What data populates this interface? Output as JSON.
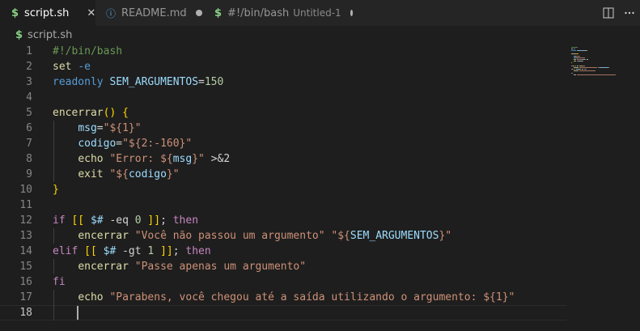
{
  "tabs": [
    {
      "label": "script.sh",
      "icon": "$",
      "icon_name": "shell-file-icon",
      "state": "active"
    },
    {
      "label": "README.md",
      "icon": "ⓘ",
      "icon_name": "info-file-icon",
      "state": "modified"
    },
    {
      "label": "#!/bin/bash",
      "description": "Untitled-1",
      "icon": "$",
      "icon_name": "shell-file-icon",
      "state": "modified"
    }
  ],
  "close_glyph": "✕",
  "breadcrumb": {
    "icon": "$",
    "label": "script.sh"
  },
  "active_line": 18,
  "code_lines": [
    {
      "n": 1,
      "tokens": [
        {
          "t": "#!/bin/bash",
          "c": "com"
        }
      ]
    },
    {
      "n": 2,
      "tokens": [
        {
          "t": "set",
          "c": "fn"
        },
        {
          "t": " ",
          "c": "txt"
        },
        {
          "t": "-e",
          "c": "kw"
        }
      ]
    },
    {
      "n": 3,
      "tokens": [
        {
          "t": "readonly",
          "c": "kw"
        },
        {
          "t": " ",
          "c": "txt"
        },
        {
          "t": "SEM_ARGUMENTOS",
          "c": "var"
        },
        {
          "t": "=",
          "c": "txt"
        },
        {
          "t": "150",
          "c": "num"
        }
      ]
    },
    {
      "n": 4,
      "tokens": []
    },
    {
      "n": 5,
      "tokens": [
        {
          "t": "encerrar",
          "c": "fn"
        },
        {
          "t": "()",
          "c": "br1"
        },
        {
          "t": " ",
          "c": "txt"
        },
        {
          "t": "{",
          "c": "br1"
        }
      ]
    },
    {
      "n": 6,
      "tokens": [
        {
          "t": "    ",
          "c": "txt"
        },
        {
          "t": "msg",
          "c": "var"
        },
        {
          "t": "=",
          "c": "txt"
        },
        {
          "t": "\"${1}\"",
          "c": "str"
        }
      ]
    },
    {
      "n": 7,
      "tokens": [
        {
          "t": "    ",
          "c": "txt"
        },
        {
          "t": "codigo",
          "c": "var"
        },
        {
          "t": "=",
          "c": "txt"
        },
        {
          "t": "\"${2:-160}\"",
          "c": "str"
        }
      ]
    },
    {
      "n": 8,
      "tokens": [
        {
          "t": "    ",
          "c": "txt"
        },
        {
          "t": "echo",
          "c": "fn"
        },
        {
          "t": " ",
          "c": "txt"
        },
        {
          "t": "\"Error: ${",
          "c": "str"
        },
        {
          "t": "msg",
          "c": "var"
        },
        {
          "t": "}\"",
          "c": "str"
        },
        {
          "t": " >&2",
          "c": "txt"
        }
      ]
    },
    {
      "n": 9,
      "tokens": [
        {
          "t": "    ",
          "c": "txt"
        },
        {
          "t": "exit",
          "c": "fn"
        },
        {
          "t": " ",
          "c": "txt"
        },
        {
          "t": "\"${",
          "c": "str"
        },
        {
          "t": "codigo",
          "c": "var"
        },
        {
          "t": "}\"",
          "c": "str"
        }
      ]
    },
    {
      "n": 10,
      "tokens": [
        {
          "t": "}",
          "c": "br1"
        }
      ]
    },
    {
      "n": 11,
      "tokens": []
    },
    {
      "n": 12,
      "tokens": [
        {
          "t": "if",
          "c": "ctl"
        },
        {
          "t": " ",
          "c": "txt"
        },
        {
          "t": "[[",
          "c": "br1"
        },
        {
          "t": " ",
          "c": "txt"
        },
        {
          "t": "$#",
          "c": "var"
        },
        {
          "t": " -eq ",
          "c": "txt"
        },
        {
          "t": "0",
          "c": "num"
        },
        {
          "t": " ",
          "c": "txt"
        },
        {
          "t": "]]",
          "c": "br1"
        },
        {
          "t": "; ",
          "c": "txt"
        },
        {
          "t": "then",
          "c": "ctl"
        }
      ]
    },
    {
      "n": 13,
      "tokens": [
        {
          "t": "    ",
          "c": "txt"
        },
        {
          "t": "encerrar",
          "c": "fn"
        },
        {
          "t": " ",
          "c": "txt"
        },
        {
          "t": "\"Você não passou um argumento\"",
          "c": "str"
        },
        {
          "t": " ",
          "c": "txt"
        },
        {
          "t": "\"${",
          "c": "str"
        },
        {
          "t": "SEM_ARGUMENTOS",
          "c": "var"
        },
        {
          "t": "}\"",
          "c": "str"
        }
      ]
    },
    {
      "n": 14,
      "tokens": [
        {
          "t": "elif",
          "c": "ctl"
        },
        {
          "t": " ",
          "c": "txt"
        },
        {
          "t": "[[",
          "c": "br1"
        },
        {
          "t": " ",
          "c": "txt"
        },
        {
          "t": "$#",
          "c": "var"
        },
        {
          "t": " -gt ",
          "c": "txt"
        },
        {
          "t": "1",
          "c": "num"
        },
        {
          "t": " ",
          "c": "txt"
        },
        {
          "t": "]]",
          "c": "br1"
        },
        {
          "t": "; ",
          "c": "txt"
        },
        {
          "t": "then",
          "c": "ctl"
        }
      ]
    },
    {
      "n": 15,
      "tokens": [
        {
          "t": "    ",
          "c": "txt"
        },
        {
          "t": "encerrar",
          "c": "fn"
        },
        {
          "t": " ",
          "c": "txt"
        },
        {
          "t": "\"Passe apenas um argumento\"",
          "c": "str"
        }
      ]
    },
    {
      "n": 16,
      "tokens": [
        {
          "t": "fi",
          "c": "ctl"
        }
      ]
    },
    {
      "n": 17,
      "tokens": [
        {
          "t": "    ",
          "c": "txt"
        },
        {
          "t": "echo",
          "c": "fn"
        },
        {
          "t": " ",
          "c": "txt"
        },
        {
          "t": "\"Parabens, você chegou até a saída utilizando o argumento: ${1}\"",
          "c": "str"
        }
      ]
    },
    {
      "n": 18,
      "tokens": []
    }
  ],
  "colors": {
    "com": "#6a9955",
    "kw": "#569cd6",
    "ctl": "#c586c0",
    "str": "#ce9178",
    "var": "#9cdcfe",
    "fn": "#dcdcaa",
    "num": "#b5cea8",
    "txt": "#d4d4d4",
    "br1": "#ffd700"
  }
}
